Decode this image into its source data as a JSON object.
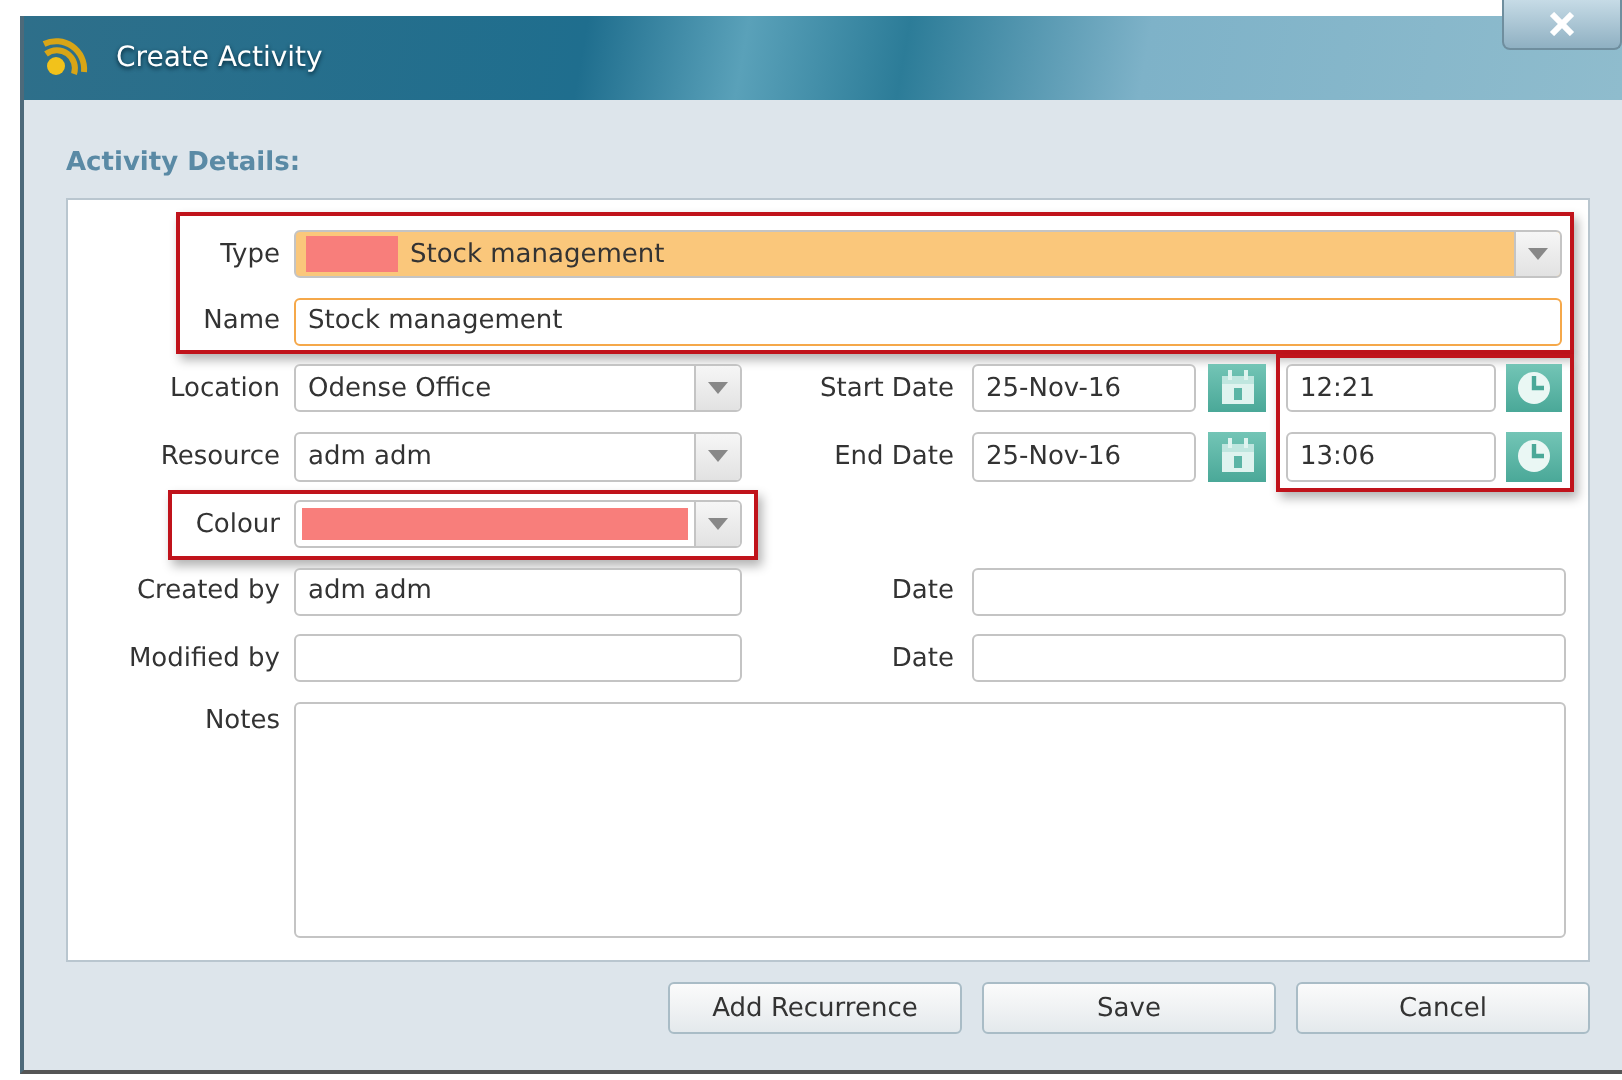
{
  "window": {
    "title": "Create Activity"
  },
  "details": {
    "heading": "Activity Details:",
    "type": {
      "label": "Type",
      "value": "Stock management",
      "color": "#f87e7b"
    },
    "name": {
      "label": "Name",
      "value": "Stock management"
    },
    "type_name_highlighted": true,
    "location": {
      "label": "Location",
      "value": "Odense Office"
    },
    "resource": {
      "label": "Resource",
      "value": "adm adm"
    },
    "colour": {
      "label": "Colour",
      "color": "#f87e7b",
      "highlighted": true
    },
    "start": {
      "label": "Start Date",
      "date": "25-Nov-16",
      "time": "12:21"
    },
    "end": {
      "label": "End Date",
      "date": "25-Nov-16",
      "time": "13:06"
    },
    "times_highlighted": true,
    "created_by": {
      "label": "Created by",
      "value": "adm adm",
      "date_label": "Date"
    },
    "modified_by": {
      "label": "Modified by",
      "date_label": "Date"
    },
    "notes": {
      "label": "Notes"
    }
  },
  "buttons": [
    {
      "label": "Add Recurrence"
    },
    {
      "label": "Save"
    },
    {
      "label": "Cancel"
    }
  ]
}
